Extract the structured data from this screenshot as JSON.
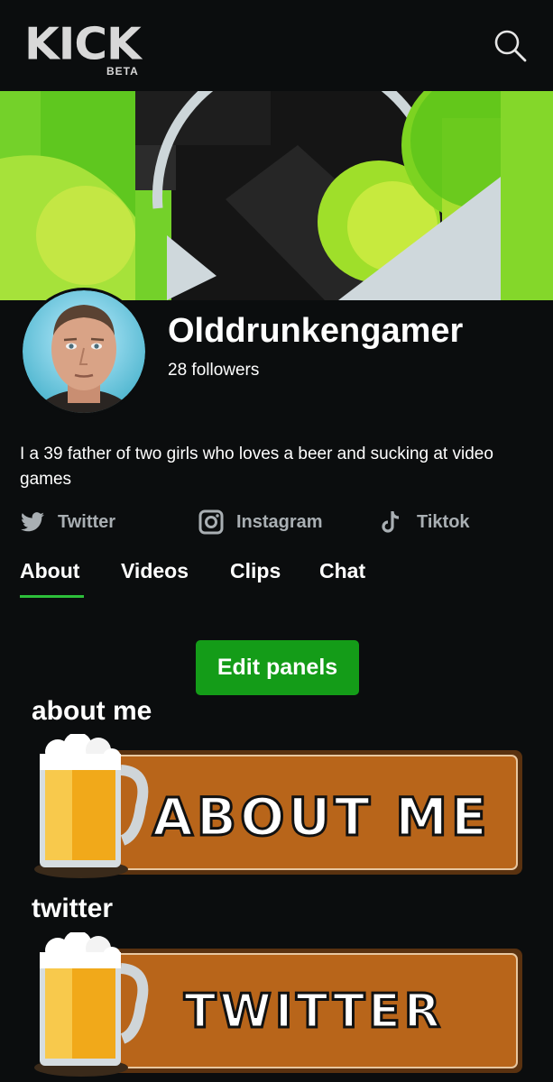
{
  "header": {
    "logo": "KICK",
    "logo_badge": "BETA",
    "search_icon": "search-icon"
  },
  "banner": {
    "colors": {
      "green": "#7ed321",
      "lime": "#b8e83a",
      "dark": "#1a1a1a",
      "pale": "#cfd8dc"
    }
  },
  "profile": {
    "username": "Olddrunkengamer",
    "followers": "28 followers",
    "bio": "I a 39 father of two girls who loves a beer and sucking at video games"
  },
  "socials": [
    {
      "label": "Twitter",
      "icon": "twitter-icon"
    },
    {
      "label": "Instagram",
      "icon": "instagram-icon"
    },
    {
      "label": "Tiktok",
      "icon": "tiktok-icon"
    }
  ],
  "tabs": [
    {
      "label": "About",
      "active": true
    },
    {
      "label": "Videos",
      "active": false
    },
    {
      "label": "Clips",
      "active": false
    },
    {
      "label": "Chat",
      "active": false
    }
  ],
  "edit_button": "Edit panels",
  "panels": [
    {
      "title": "about me",
      "image_text": "ABOUT ME"
    },
    {
      "title": "twitter",
      "image_text": "TWITTER"
    }
  ],
  "colors": {
    "accent": "#149c18",
    "background": "#0b0d0e",
    "muted": "#a9afb3",
    "panel_orange": "#b8651a"
  }
}
